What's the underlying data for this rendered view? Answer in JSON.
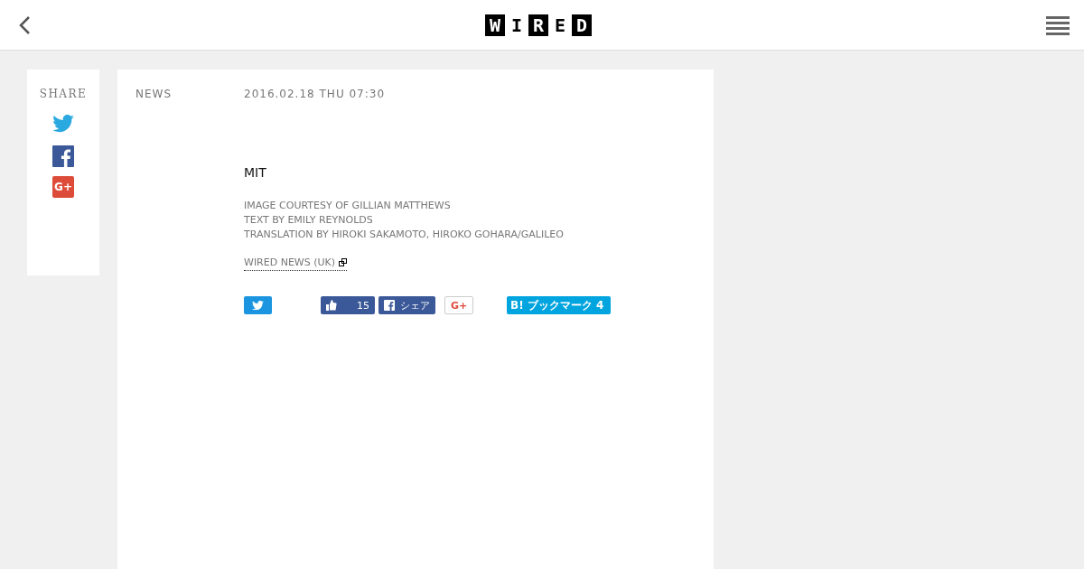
{
  "header": {
    "logo": [
      {
        "char": "W",
        "boxed": true
      },
      {
        "char": "I",
        "boxed": false
      },
      {
        "char": "R",
        "boxed": true
      },
      {
        "char": "E",
        "boxed": false
      },
      {
        "char": "D",
        "boxed": true
      }
    ]
  },
  "share": {
    "title": "SHARE",
    "gplus": "G+"
  },
  "article": {
    "category": "NEWS",
    "date": "2016.02.18 THU 07:30",
    "title": "MIT",
    "credits": [
      "IMAGE COURTESY OF GILLIAN MATTHEWS",
      "TEXT BY EMILY REYNOLDS",
      "TRANSLATION BY HIROKI SAKAMOTO, HIROKO GOHARA/GALILEO"
    ],
    "source": "WIRED NEWS (UK)",
    "buttons": [
      {
        "kind": "tweet"
      },
      {
        "kind": "like",
        "count": "15"
      },
      {
        "kind": "fbshare",
        "label": "シェア"
      },
      {
        "kind": "gplus",
        "label": "G+"
      },
      {
        "kind": "hatena",
        "mark": "B!",
        "label": "ブックマーク",
        "count": "4"
      }
    ]
  }
}
